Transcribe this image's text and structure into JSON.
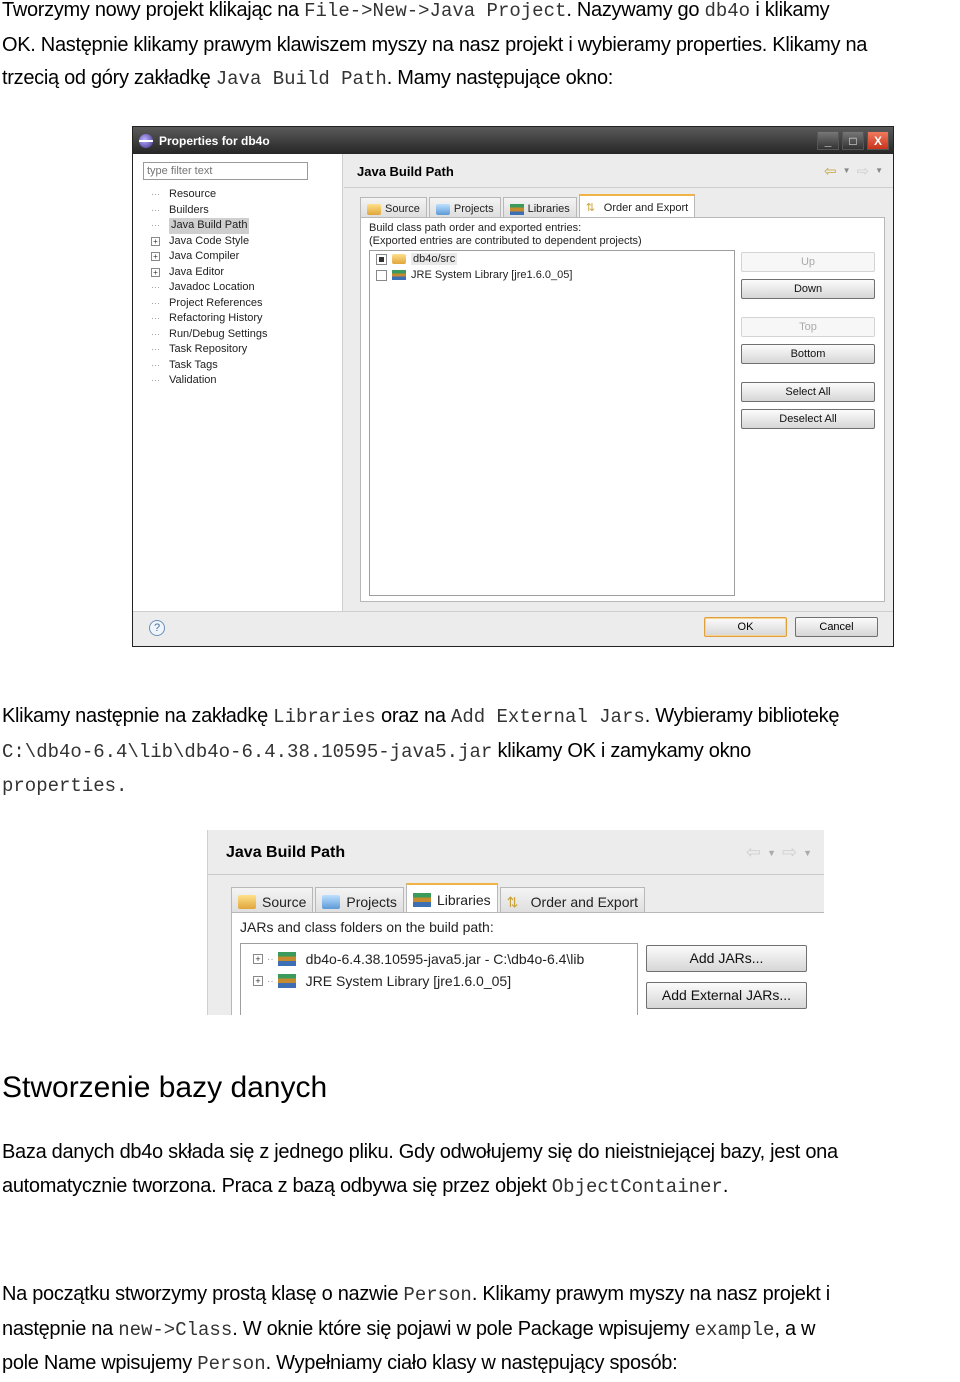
{
  "paragraphs": {
    "p1": {
      "l1_a": "Tworzymy nowy projekt klikając na ",
      "l1_code1": "File->New->Java Project",
      "l1_b": ". Nazywamy go ",
      "l1_code2": "db4o",
      "l1_c": " i klikamy",
      "l2": "OK. Następnie klikamy prawym klawiszem myszy na nasz projekt i wybieramy properties. Klikamy na",
      "l3_a": "trzecią od góry zakładkę ",
      "l3_code": "Java Build Path",
      "l3_b": ". Mamy następujące okno:"
    },
    "p2": {
      "l1_a": "Klikamy następnie na zakładkę ",
      "l1_code1": "Libraries",
      "l1_b": " oraz na ",
      "l1_code2": "Add External Jars",
      "l1_c": ". Wybieramy bibliotekę",
      "l2_code": "C:\\db4o-6.4\\lib\\db4o-6.4.38.10595-java5.jar",
      "l2_b": " klikamy OK i zamykamy okno",
      "l3_code": "properties."
    },
    "heading": "Stworzenie bazy danych",
    "p3": {
      "l1": "Baza danych db4o składa się z jednego pliku. Gdy odwołujemy się do nieistniejącej bazy, jest ona",
      "l2_a": "automatycznie tworzona. Praca z bazą odbywa się przez objekt ",
      "l2_code": "ObjectContainer",
      "l2_b": "."
    },
    "p4": {
      "l1_a": "Na początku stworzymy prostą klasę o nazwie ",
      "l1_code": "Person",
      "l1_b": ". Klikamy prawym myszy na nasz projekt i",
      "l2_a": "następnie na ",
      "l2_code1": "new->Class",
      "l2_b": ". W oknie które się pojawi w pole Package wpisujemy ",
      "l2_code2": "example",
      "l2_c": ", a w",
      "l3_a": "pole Name wpisujemy ",
      "l3_code": "Person",
      "l3_b": ". Wypełniamy ciało klasy w następujący sposób:"
    }
  },
  "window1": {
    "title": "Properties for db4o",
    "controls": {
      "minimize": "_",
      "maximize": "□",
      "close": "X"
    },
    "filter_placeholder": "type filter text",
    "tree": [
      {
        "label": "Resource",
        "expandable": false,
        "selected": false
      },
      {
        "label": "Builders",
        "expandable": false,
        "selected": false
      },
      {
        "label": "Java Build Path",
        "expandable": false,
        "selected": true
      },
      {
        "label": "Java Code Style",
        "expandable": true,
        "selected": false
      },
      {
        "label": "Java Compiler",
        "expandable": true,
        "selected": false
      },
      {
        "label": "Java Editor",
        "expandable": true,
        "selected": false
      },
      {
        "label": "Javadoc Location",
        "expandable": false,
        "selected": false
      },
      {
        "label": "Project References",
        "expandable": false,
        "selected": false
      },
      {
        "label": "Refactoring History",
        "expandable": false,
        "selected": false
      },
      {
        "label": "Run/Debug Settings",
        "expandable": false,
        "selected": false
      },
      {
        "label": "Task Repository",
        "expandable": false,
        "selected": false
      },
      {
        "label": "Task Tags",
        "expandable": false,
        "selected": false
      },
      {
        "label": "Validation",
        "expandable": false,
        "selected": false
      }
    ],
    "page_title": "Java Build Path",
    "tabs": [
      "Source",
      "Projects",
      "Libraries",
      "Order and Export"
    ],
    "active_tab": "Order and Export",
    "description_line1": "Build class path order and exported entries:",
    "description_line2": "(Exported entries are contributed to dependent projects)",
    "entries": [
      {
        "label": "db4o/src",
        "checked": true
      },
      {
        "label": "JRE System Library [jre1.6.0_05]",
        "checked": false
      }
    ],
    "buttons": {
      "up": "Up",
      "down": "Down",
      "top": "Top",
      "bottom": "Bottom",
      "select_all": "Select All",
      "deselect_all": "Deselect All"
    },
    "footer": {
      "help": "?",
      "ok": "OK",
      "cancel": "Cancel"
    }
  },
  "window2": {
    "page_title": "Java Build Path",
    "tabs": [
      "Source",
      "Projects",
      "Libraries",
      "Order and Export"
    ],
    "active_tab": "Libraries",
    "description": "JARs and class folders on the build path:",
    "entries": [
      "db4o-6.4.38.10595-java5.jar - C:\\db4o-6.4\\lib",
      "JRE System Library [jre1.6.0_05]"
    ],
    "buttons": {
      "add_jars": "Add JARs...",
      "add_external_jars": "Add External JARs..."
    }
  }
}
